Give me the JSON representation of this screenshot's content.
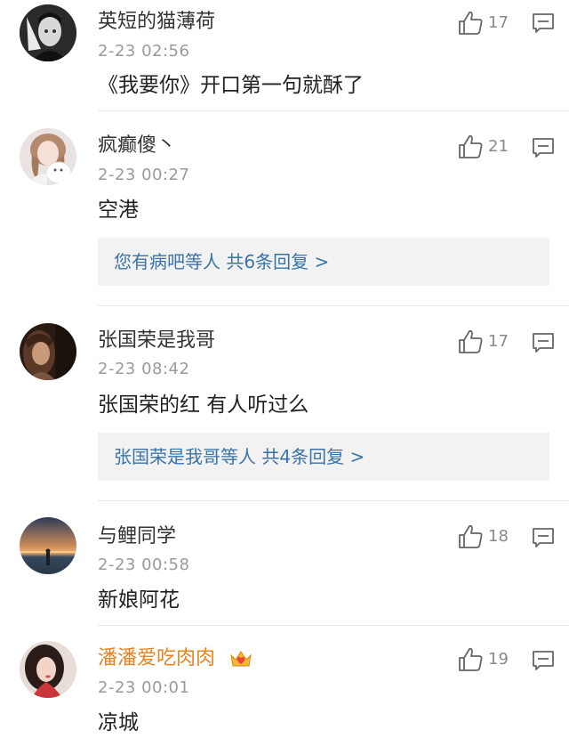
{
  "comments": [
    {
      "username": "英短的猫薄荷",
      "time": "2-23 02:56",
      "text": "《我要你》开口第一句就酥了",
      "likes": "17",
      "avatar": "avatar-dark-portrait"
    },
    {
      "username": "疯癫傻丶",
      "time": "2-23 00:27",
      "text": "空港",
      "likes": "21",
      "avatar": "avatar-girl-with-plush",
      "replies": "您有病吧等人  共6条回复 >"
    },
    {
      "username": "张国荣是我哥",
      "time": "2-23 08:42",
      "text": "张国荣的红 有人听过么",
      "likes": "17",
      "avatar": "avatar-warm-portrait",
      "replies": "张国荣是我哥等人  共4条回复 >"
    },
    {
      "username": "与鲤同学",
      "time": "2-23 00:58",
      "text": "新娘阿花",
      "likes": "18",
      "avatar": "avatar-sunset-beach"
    },
    {
      "username": "潘潘爱吃肉肉",
      "time": "2-23 00:01",
      "text": "凉城",
      "likes": "19",
      "avatar": "avatar-woman-portrait",
      "username_color": "#e8831f",
      "badge": "crown-heart-icon"
    }
  ],
  "colors": {
    "link": "#3a73a8",
    "vip_name": "#e8831f",
    "meta": "#9a9a9a"
  }
}
